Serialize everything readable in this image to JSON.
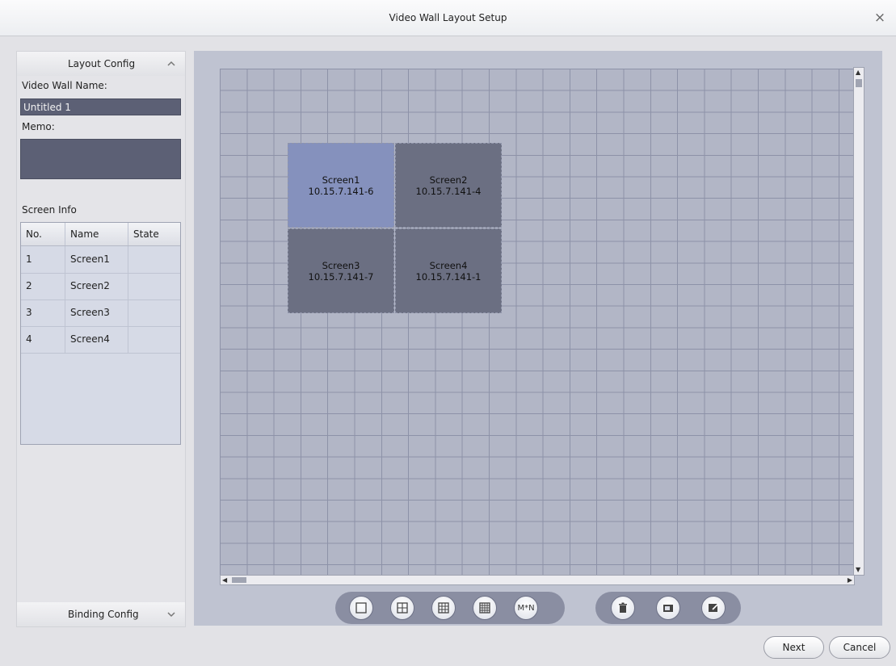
{
  "window": {
    "title": "Video Wall Layout Setup",
    "close_glyph": "×"
  },
  "left_panel": {
    "layout_header": "Layout Config",
    "name_label": "Video Wall Name:",
    "name_value": "Untitled 1",
    "memo_label": "Memo:",
    "memo_value": "",
    "screen_info_label": "Screen Info",
    "table": {
      "headers": [
        "No.",
        "Name",
        "State"
      ],
      "rows": [
        {
          "no": "1",
          "name": "Screen1",
          "state": ""
        },
        {
          "no": "2",
          "name": "Screen2",
          "state": ""
        },
        {
          "no": "3",
          "name": "Screen3",
          "state": ""
        },
        {
          "no": "4",
          "name": "Screen4",
          "state": ""
        }
      ]
    },
    "binding_header": "Binding Config"
  },
  "screens": [
    {
      "name": "Screen1",
      "ip": "10.15.7.141-6",
      "selected": true
    },
    {
      "name": "Screen2",
      "ip": "10.15.7.141-4",
      "selected": false
    },
    {
      "name": "Screen3",
      "ip": "10.15.7.141-7",
      "selected": false
    },
    {
      "name": "Screen4",
      "ip": "10.15.7.141-1",
      "selected": false
    }
  ],
  "toolbar": {
    "layout_buttons": [
      "layout-1x1-icon",
      "layout-2x2-icon",
      "layout-3x3-icon",
      "layout-4x4-icon",
      "layout-mxn-icon"
    ],
    "mxn_label": "M*N",
    "edit_buttons": [
      "delete-icon",
      "screen-icon",
      "edit-icon"
    ]
  },
  "footer": {
    "next": "Next",
    "cancel": "Cancel"
  },
  "colors": {
    "canvas_bg": "#bfc3d1",
    "grid_bg": "#b2b6c6",
    "tile_selected": "#8591bd",
    "tile_normal": "#6b6f82",
    "input_bg": "#5c6075"
  }
}
